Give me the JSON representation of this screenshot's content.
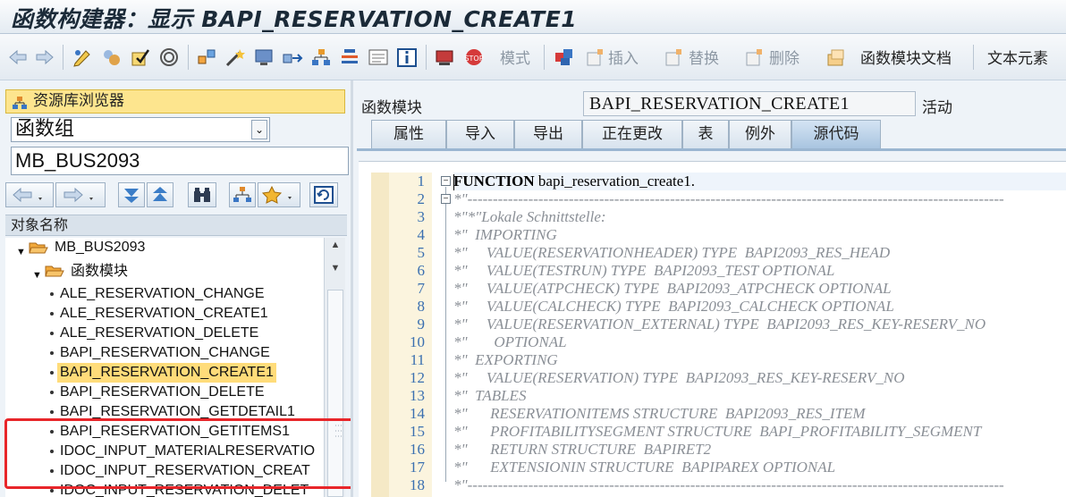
{
  "window": {
    "title": "函数构建器：显示 BAPI_RESERVATION_CREATE1"
  },
  "toolbar": {
    "mode_label": "模式",
    "insert_label": "插入",
    "replace_label": "替换",
    "delete_label": "删除",
    "fm_doc_label": "函数模块文档",
    "text_elements_label": "文本元素"
  },
  "left": {
    "repo_browser_label": "资源库浏览器",
    "object_type_value": "函数组",
    "object_name_value": "MB_BUS2093",
    "tree_header": "对象名称",
    "tree": {
      "root": "MB_BUS2093",
      "folder": "函数模块",
      "items": [
        "ALE_RESERVATION_CHANGE",
        "ALE_RESERVATION_CREATE1",
        "ALE_RESERVATION_DELETE",
        "BAPI_RESERVATION_CHANGE",
        "BAPI_RESERVATION_CREATE1",
        "BAPI_RESERVATION_DELETE",
        "BAPI_RESERVATION_GETDETAIL1",
        "BAPI_RESERVATION_GETITEMS1",
        "IDOC_INPUT_MATERIALRESERVATIO",
        "IDOC_INPUT_RESERVATION_CREAT",
        "IDOC_INPUT_RESERVATION_DELET"
      ],
      "selected_index": 4
    }
  },
  "right": {
    "fm_label": "函数模块",
    "fm_name": "BAPI_RESERVATION_CREATE1",
    "status": "活动",
    "tabs": [
      "属性",
      "导入",
      "导出",
      "正在更改",
      "表",
      "例外",
      "源代码"
    ],
    "active_tab": "源代码"
  },
  "code": {
    "line_numbers": [
      "1",
      "2",
      "3",
      "4",
      "5",
      "6",
      "7",
      "8",
      "9",
      "10",
      "11",
      "12",
      "13",
      "14",
      "15",
      "16",
      "17",
      "18"
    ],
    "lines": [
      {
        "kw": "FUNCTION",
        "rest": " bapi_reservation_create1."
      },
      {
        "c": "*\"----------------------------------------------------------------------------------------------------------"
      },
      {
        "c": "*\"*\"Lokale Schnittstelle:"
      },
      {
        "c": "*\"  IMPORTING"
      },
      {
        "c": "*\"     VALUE(RESERVATIONHEADER) TYPE  BAPI2093_RES_HEAD"
      },
      {
        "c": "*\"     VALUE(TESTRUN) TYPE  BAPI2093_TEST OPTIONAL"
      },
      {
        "c": "*\"     VALUE(ATPCHECK) TYPE  BAPI2093_ATPCHECK OPTIONAL"
      },
      {
        "c": "*\"     VALUE(CALCHECK) TYPE  BAPI2093_CALCHECK OPTIONAL"
      },
      {
        "c": "*\"     VALUE(RESERVATION_EXTERNAL) TYPE  BAPI2093_RES_KEY-RESERV_NO"
      },
      {
        "c": "*\"       OPTIONAL"
      },
      {
        "c": "*\"  EXPORTING"
      },
      {
        "c": "*\"     VALUE(RESERVATION) TYPE  BAPI2093_RES_KEY-RESERV_NO"
      },
      {
        "c": "*\"  TABLES"
      },
      {
        "c": "*\"      RESERVATIONITEMS STRUCTURE  BAPI2093_RES_ITEM"
      },
      {
        "c": "*\"      PROFITABILITYSEGMENT STRUCTURE  BAPI_PROFITABILITY_SEGMENT"
      },
      {
        "c": "*\"      RETURN STRUCTURE  BAPIRET2"
      },
      {
        "c": "*\"      EXTENSIONIN STRUCTURE  BAPIPAREX OPTIONAL"
      },
      {
        "c": "*\"----------------------------------------------------------------------------------------------------------"
      }
    ]
  }
}
